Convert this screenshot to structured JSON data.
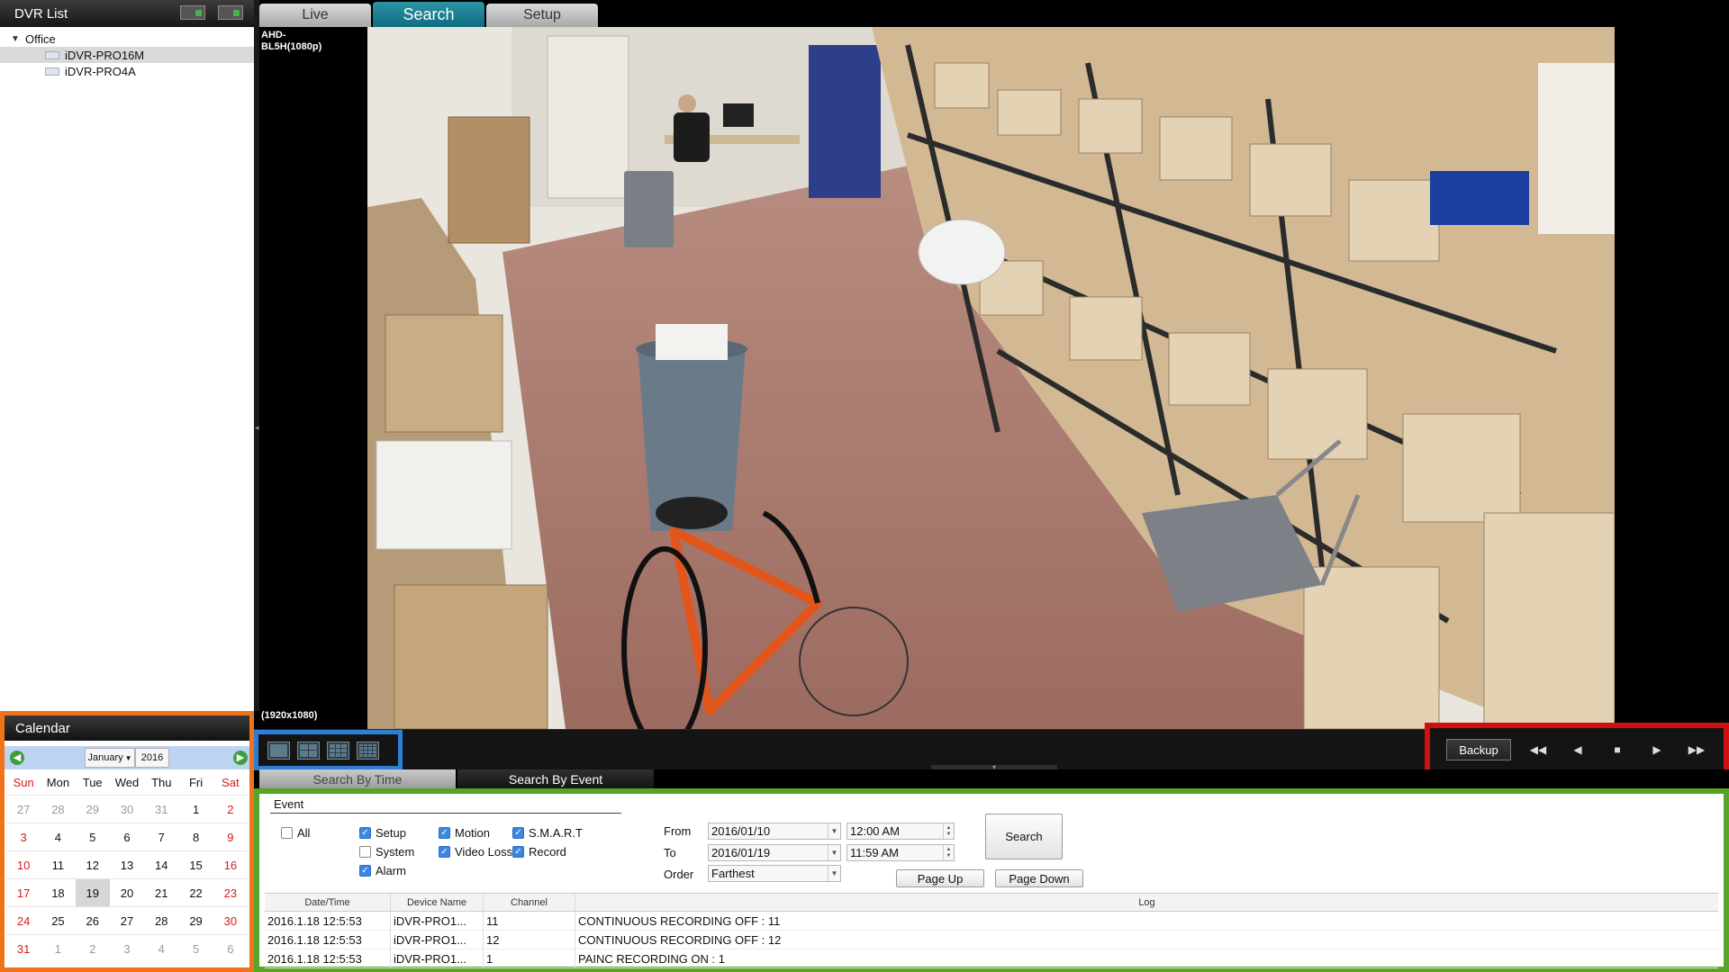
{
  "dvr_list": {
    "title": "DVR List",
    "group": "Office",
    "devices": [
      {
        "name": "iDVR-PRO16M",
        "selected": true
      },
      {
        "name": "iDVR-PRO4A",
        "selected": false
      }
    ]
  },
  "tabs": [
    {
      "label": "Live",
      "active": false
    },
    {
      "label": "Search",
      "active": true
    },
    {
      "label": "Setup",
      "active": false
    }
  ],
  "video": {
    "camera_osd_line1": "AHD-",
    "camera_osd_line2": "BL5H(1080p)",
    "resolution_osd": "(1920x1080)"
  },
  "controls": {
    "backup_label": "Backup",
    "buttons": [
      {
        "name": "fast-rewind-icon",
        "glyph": "◀◀"
      },
      {
        "name": "step-back-icon",
        "glyph": "◀"
      },
      {
        "name": "stop-icon",
        "glyph": "■"
      },
      {
        "name": "play-icon",
        "glyph": "▶"
      },
      {
        "name": "fast-forward-icon",
        "glyph": "▶▶"
      }
    ]
  },
  "calendar": {
    "title": "Calendar",
    "month": "January",
    "year": "2016",
    "weekdays": [
      "Sun",
      "Mon",
      "Tue",
      "Wed",
      "Thu",
      "Fri",
      "Sat"
    ],
    "weeks": [
      [
        "27",
        "28",
        "29",
        "30",
        "31",
        "1",
        "2"
      ],
      [
        "3",
        "4",
        "5",
        "6",
        "7",
        "8",
        "9"
      ],
      [
        "10",
        "11",
        "12",
        "13",
        "14",
        "15",
        "16"
      ],
      [
        "17",
        "18",
        "19",
        "20",
        "21",
        "22",
        "23"
      ],
      [
        "24",
        "25",
        "26",
        "27",
        "28",
        "29",
        "30"
      ],
      [
        "31",
        "1",
        "2",
        "3",
        "4",
        "5",
        "6"
      ]
    ],
    "selected_day": "19"
  },
  "search_tabs": [
    {
      "label": "Search By Time",
      "active": false
    },
    {
      "label": "Search By Event",
      "active": true
    }
  ],
  "event_search": {
    "legend": "Event",
    "checkboxes": {
      "all": {
        "label": "All",
        "checked": false
      },
      "setup": {
        "label": "Setup",
        "checked": true
      },
      "system": {
        "label": "System",
        "checked": false
      },
      "alarm": {
        "label": "Alarm",
        "checked": true
      },
      "motion": {
        "label": "Motion",
        "checked": true
      },
      "video_loss": {
        "label": "Video Loss",
        "checked": true
      },
      "smart": {
        "label": "S.M.A.R.T",
        "checked": true
      },
      "record": {
        "label": "Record",
        "checked": true
      }
    },
    "from_label": "From",
    "from_date": "2016/01/10",
    "from_time": "12:00 AM",
    "to_label": "To",
    "to_date": "2016/01/19",
    "to_time": "11:59 AM",
    "order_label": "Order",
    "order_value": "Farthest",
    "search_label": "Search",
    "page_up_label": "Page Up",
    "page_down_label": "Page Down"
  },
  "results": {
    "headers": [
      "Date/Time",
      "Device Name",
      "Channel",
      "Log"
    ],
    "rows": [
      [
        "2016.1.18 12:5:53",
        "iDVR-PRO1...",
        "11",
        "CONTINUOUS RECORDING OFF : 11"
      ],
      [
        "2016.1.18 12:5:53",
        "iDVR-PRO1...",
        "12",
        "CONTINUOUS RECORDING OFF : 12"
      ],
      [
        "2016.1.18 12:5:53",
        "iDVR-PRO1...",
        "1",
        "PAINC RECORDING ON : 1"
      ]
    ]
  },
  "colors": {
    "calendar_border": "#f0731c",
    "layout_border": "#2d7fd6",
    "playback_border": "#d10f0f",
    "search_border": "#57a426",
    "active_tab": "#1a7f92"
  }
}
